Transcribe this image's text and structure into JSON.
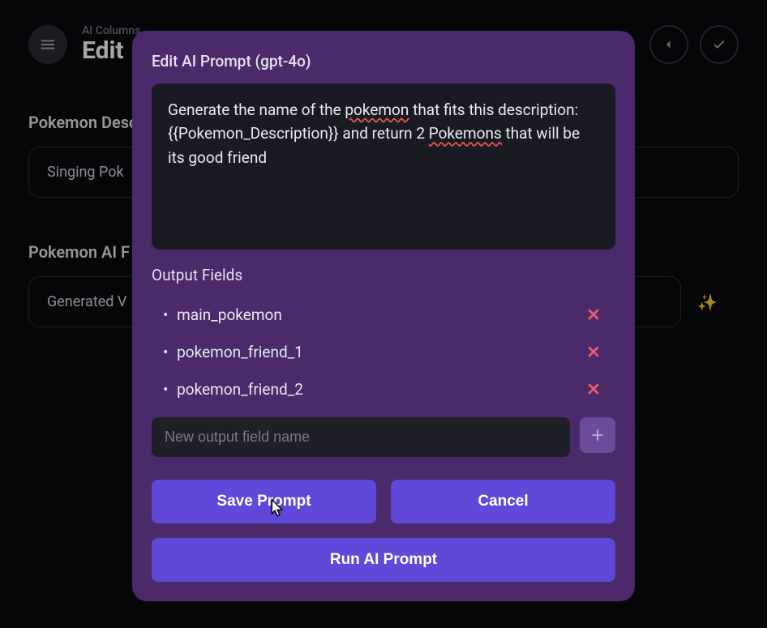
{
  "header": {
    "subtitle": "AI Columns",
    "title": "Edit"
  },
  "bg": {
    "field1_label": "Pokemon Description",
    "field1_value": "Singing Pok",
    "field2_label": "Pokemon AI F",
    "field2_value": "Generated V"
  },
  "modal": {
    "title": "Edit AI Prompt (gpt-4o)",
    "prompt_pre": "Generate the name of the ",
    "prompt_w1": "pokemon",
    "prompt_mid1": " that fits this description: {{Pokemon_Description}} and return 2 ",
    "prompt_w2": "Pokemons",
    "prompt_mid2": " that will be its good friend",
    "output_label": "Output Fields",
    "outputs": {
      "0": "main_pokemon",
      "1": "pokemon_friend_1",
      "2": "pokemon_friend_2"
    },
    "new_field_placeholder": "New output field name",
    "save_label": "Save Prompt",
    "cancel_label": "Cancel",
    "run_label": "Run AI Prompt"
  }
}
